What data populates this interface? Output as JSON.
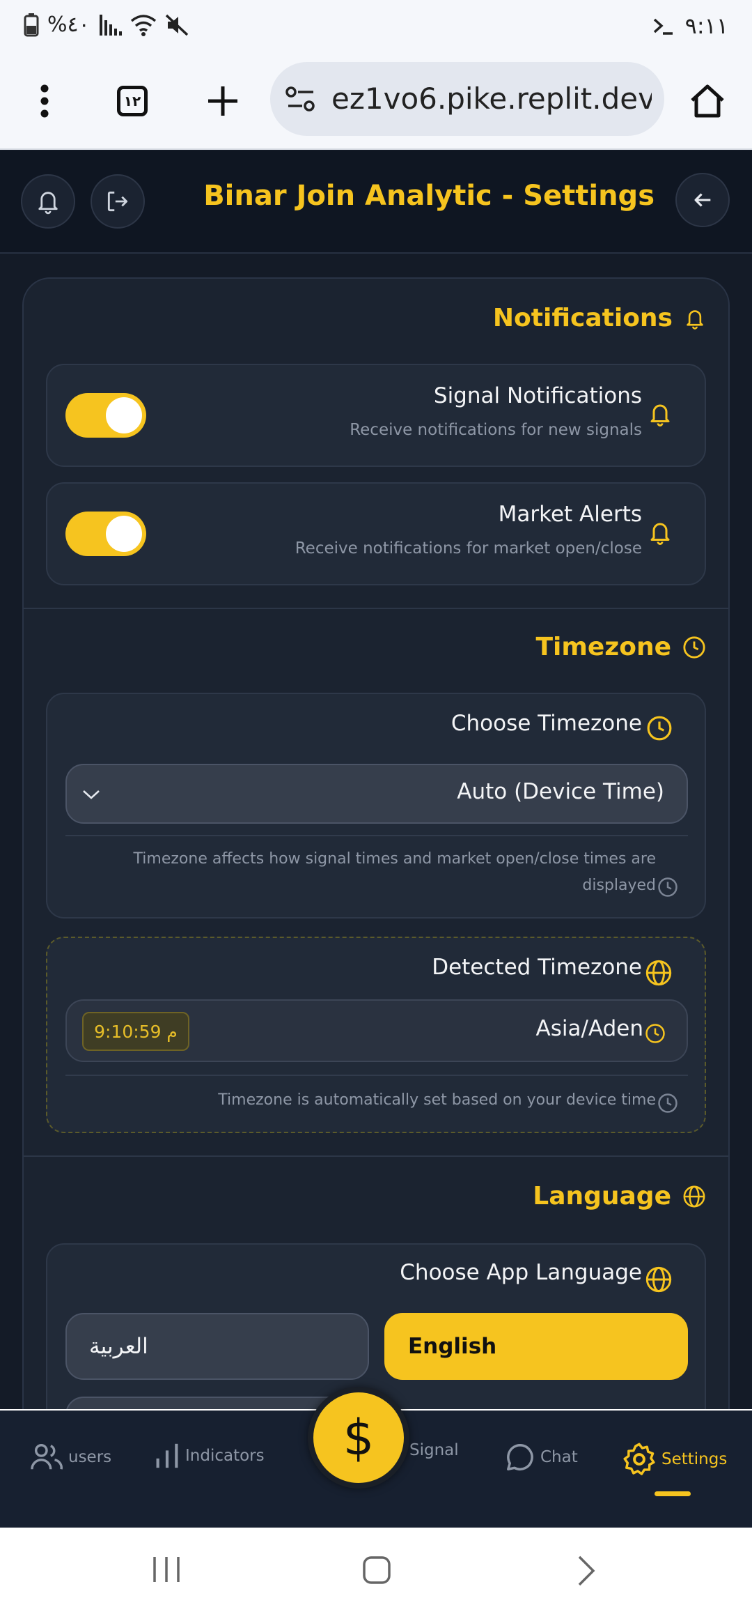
{
  "status_bar": {
    "battery": "%٤٠",
    "time": "٩:١١",
    "terminal_icon": "terminal-icon"
  },
  "browser": {
    "tab_count": "١٢",
    "url": "ez1vo6.pike.replit.dev"
  },
  "header": {
    "title": "Binar Join Analytic - Settings"
  },
  "notifications": {
    "title": "Notifications",
    "items": [
      {
        "title": "Signal Notifications",
        "description": "Receive notifications for new signals",
        "enabled": true
      },
      {
        "title": "Market Alerts",
        "description": "Receive notifications for market open/close",
        "enabled": true
      }
    ]
  },
  "timezone": {
    "title": "Timezone",
    "choose_label": "Choose Timezone",
    "selected": "Auto (Device Time)",
    "note_line1": "Timezone affects how signal times and market open/close times are",
    "note_line2": "displayed",
    "detected_label": "Detected Timezone",
    "detected_value": "Asia/Aden",
    "current_time": "9:10:59 م",
    "detected_note": "Timezone is automatically set based on your device time"
  },
  "language": {
    "title": "Language",
    "choose_label": "Choose App Language",
    "options": [
      "English",
      "العربية"
    ],
    "selected": "English"
  },
  "bottom_nav": {
    "items": [
      "users",
      "Indicators",
      "Signal",
      "Chat",
      "Settings"
    ],
    "active": "Settings",
    "fab_symbol": "$"
  },
  "colors": {
    "accent": "#f6c41f",
    "background": "#141b27",
    "card": "#1b2330"
  }
}
